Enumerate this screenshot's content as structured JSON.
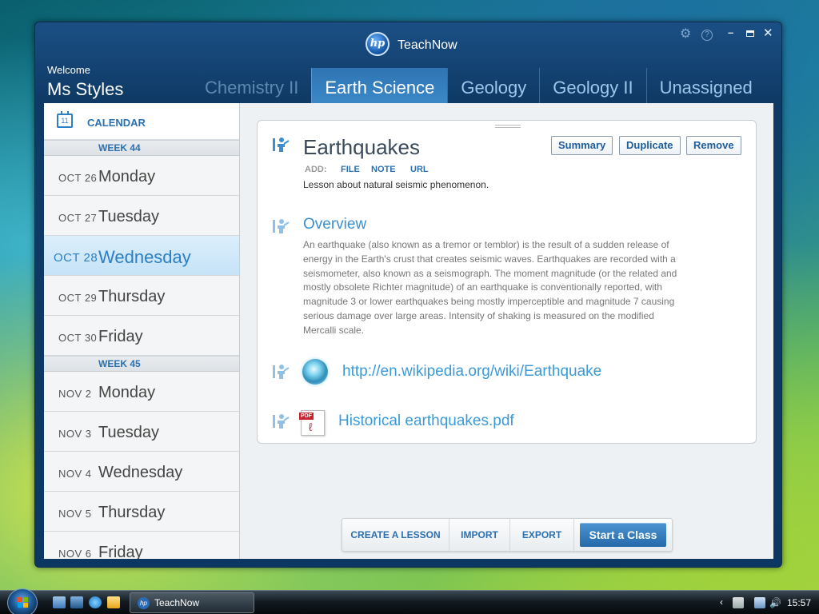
{
  "window": {
    "title": "TeachNow",
    "logo_text": "hp"
  },
  "header": {
    "welcome": "Welcome",
    "username": "Ms Styles"
  },
  "tabs": [
    {
      "label": "Chemistry II",
      "active": false
    },
    {
      "label": "Earth Science",
      "active": true
    },
    {
      "label": "Geology",
      "active": false
    },
    {
      "label": "Geology II",
      "active": false
    },
    {
      "label": "Unassigned",
      "active": false
    }
  ],
  "sidebar": {
    "calendar_label": "CALENDAR",
    "calendar_icon_day": "11",
    "week44": "WEEK 44",
    "week45": "WEEK 45",
    "days": [
      {
        "date": "OCT 26",
        "name": "Monday"
      },
      {
        "date": "OCT 27",
        "name": "Tuesday"
      },
      {
        "date": "OCT 28",
        "name": "Wednesday",
        "selected": true
      },
      {
        "date": "OCT 29",
        "name": "Thursday"
      },
      {
        "date": "OCT 30",
        "name": "Friday"
      },
      {
        "date": "NOV 2",
        "name": "Monday"
      },
      {
        "date": "NOV 3",
        "name": "Tuesday"
      },
      {
        "date": "NOV 4",
        "name": "Wednesday"
      },
      {
        "date": "NOV 5",
        "name": "Thursday"
      },
      {
        "date": "NOV 6",
        "name": "Friday"
      }
    ]
  },
  "lesson": {
    "title": "Earthquakes",
    "add_label": "ADD:",
    "add_file": "FILE",
    "add_note": "NOTE",
    "add_url": "URL",
    "description": "Lesson about natural seismic phenomenon.",
    "buttons": {
      "summary": "Summary",
      "duplicate": "Duplicate",
      "remove": "Remove"
    },
    "overview_title": "Overview",
    "overview_text": "An earthquake (also known as a tremor or temblor) is the result of a sudden release of energy in the Earth's crust that creates seismic waves. Earthquakes are recorded with a seismometer, also known as a seismograph. The moment magnitude (or the related and mostly obsolete Richter magnitude) of an earthquake is conventionally reported, with magnitude 3 or lower earthquakes being mostly imperceptible and magnitude 7 causing serious damage over large areas. Intensity of shaking is measured on the modified Mercalli scale.",
    "url": "http://en.wikipedia.org/wiki/Earthquake",
    "file_name": "Historical earthquakes.pdf",
    "pdf_tag": "PDF"
  },
  "toolbar": {
    "create_lesson": "CREATE A LESSON",
    "import": "IMPORT",
    "export": "EXPORT",
    "start_class": "Start a Class"
  },
  "taskbar": {
    "task_label": "TeachNow",
    "clock": "15:57"
  },
  "colors": {
    "accent": "#2a70b2",
    "link": "#3b9ad8",
    "tab_active": "#3b88c7"
  }
}
